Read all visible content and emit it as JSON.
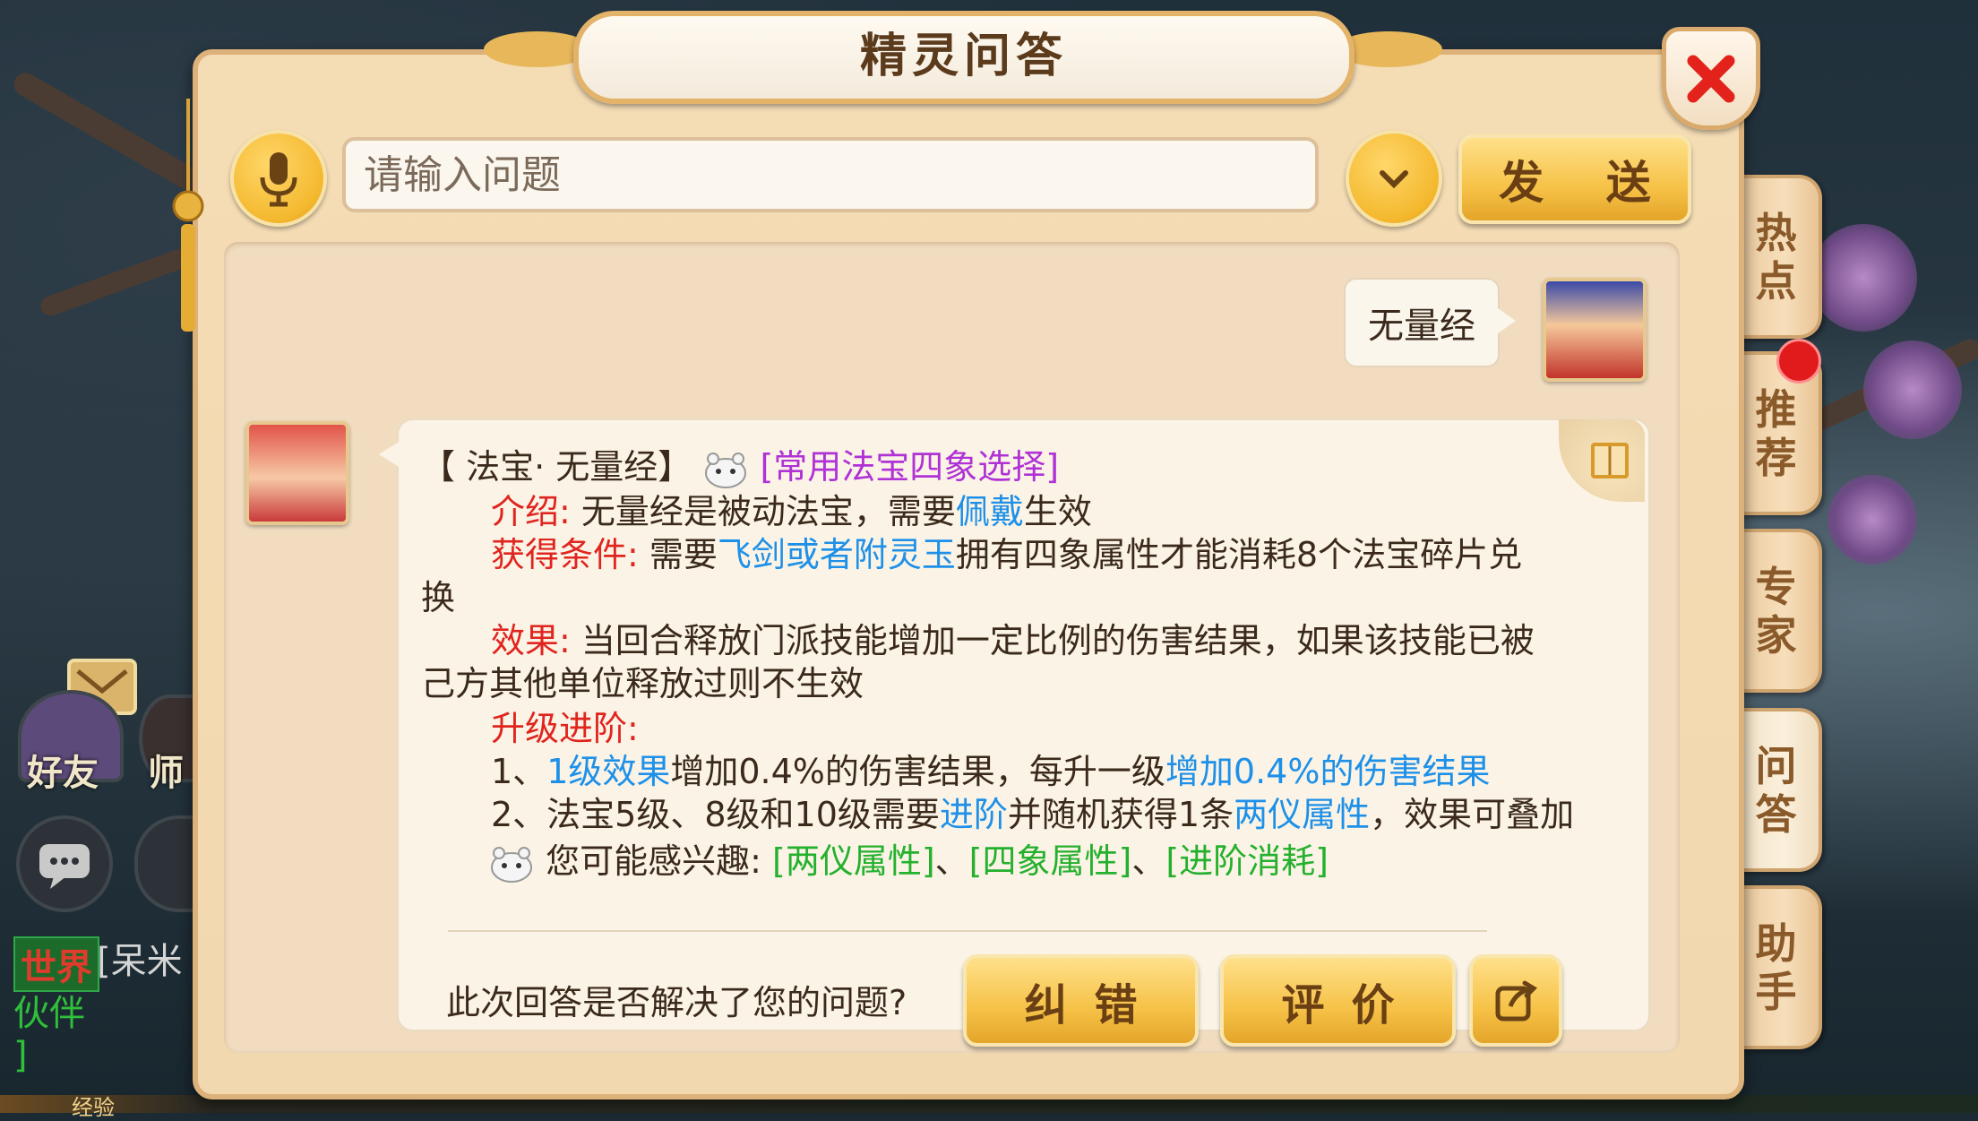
{
  "title": "精灵问答",
  "search": {
    "placeholder": "请输入问题",
    "send_label": "发 送"
  },
  "side_tabs": [
    {
      "label": "热点"
    },
    {
      "label": "推荐"
    },
    {
      "label": "专家"
    },
    {
      "label": "问答"
    },
    {
      "label": "助手"
    }
  ],
  "user_query": "无量经",
  "answer": {
    "heading_prefix": "【 法宝· 无量经】",
    "heading_link": "[常用法宝四象选择]",
    "intro_label": "介绍:",
    "intro_text_a": " 无量经是被动法宝，需要",
    "intro_link": "佩戴",
    "intro_text_b": "生效",
    "cond_label": "获得条件:",
    "cond_text_a": " 需要",
    "cond_link": "飞剑或者附灵玉",
    "cond_text_b": "拥有四象属性才能消耗8个法宝碎片兑",
    "cond_text_c": "换",
    "effect_label": "效果:",
    "effect_text_a": " 当回合释放门派技能增加一定比例的伤害结果，如果该技能已被",
    "effect_text_b": "己方其他单位释放过则不生效",
    "upgrade_label": "升级进阶:",
    "up1_prefix": "1、",
    "up1_link": "1级效果",
    "up1_text": "增加0.4%的伤害结果，每升一级",
    "up1_link2": "增加0.4%的伤害结果",
    "up2_prefix": "2、法宝5级、8级和10级需要",
    "up2_link": "进阶",
    "up2_text": "并随机获得1条",
    "up2_link2": "两仪属性",
    "up2_text2": "，效果可叠加",
    "interest_text": "您可能感兴趣:",
    "interest_links": [
      "[两仪属性]",
      "[四象属性]",
      "[进阶消耗]"
    ],
    "interest_sep": "、"
  },
  "footer": {
    "question": "此次回答是否解决了您的问题?",
    "correct_label": "纠错",
    "rate_label": "评价"
  },
  "hud": {
    "friends": "好友",
    "master": "师",
    "world_channel": "世界",
    "chat_name": "[呆米",
    "partner": "伙伴",
    "exp": "经验",
    "bracket": "]"
  }
}
